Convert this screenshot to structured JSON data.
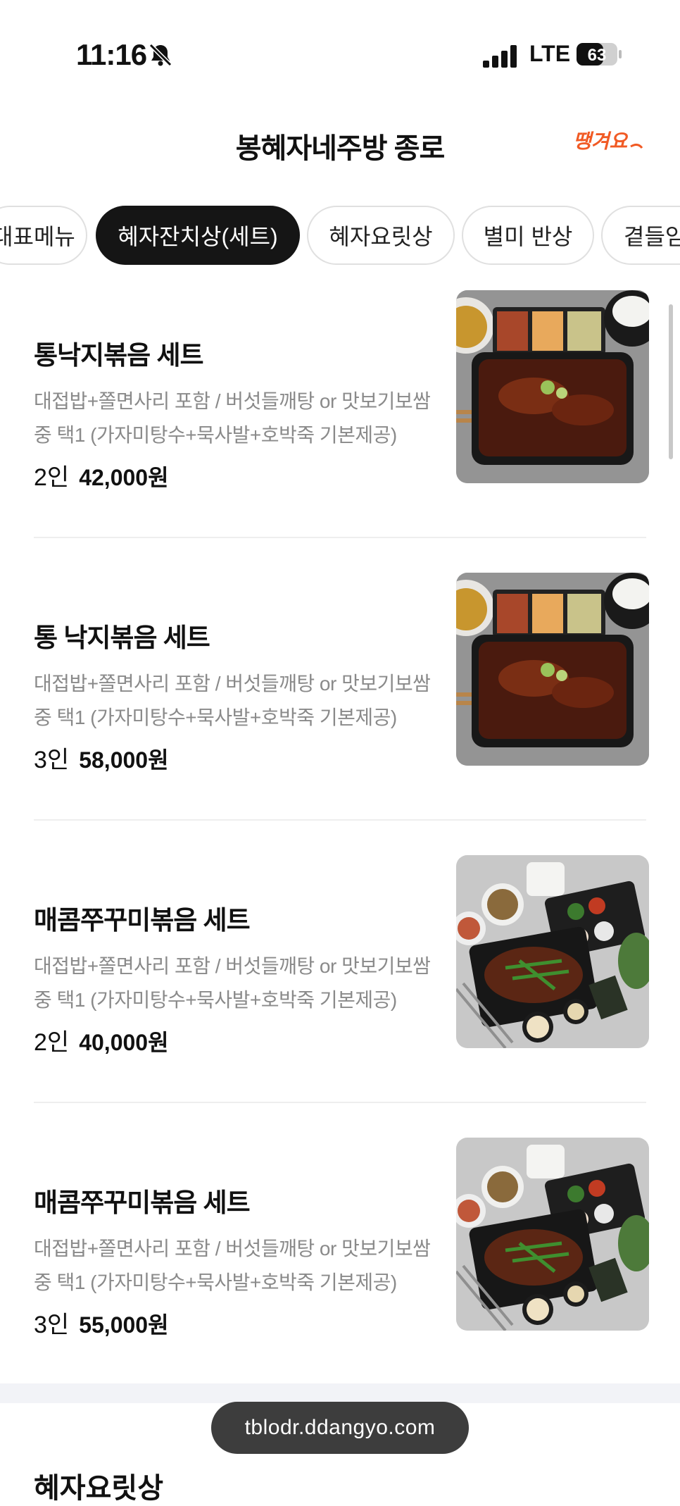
{
  "status_bar": {
    "time": "11:16",
    "network": "LTE",
    "battery": "63"
  },
  "header": {
    "title": "봉혜자네주방 종로",
    "brand_logo_text": "땡겨요"
  },
  "tabs": [
    {
      "label": "대표메뉴",
      "active": false
    },
    {
      "label": "혜자잔치상(세트)",
      "active": true
    },
    {
      "label": "혜자요릿상",
      "active": false
    },
    {
      "label": "별미 반상",
      "active": false
    },
    {
      "label": "곁들임",
      "active": false
    }
  ],
  "menu_items": [
    {
      "name": "통낙지볶음 세트",
      "desc_line1": "대접밥+쫄면사리 포함 / 버섯들깨탕 or 맛보기보쌈",
      "desc_line2": "중 택1 (가자미탕수+묵사발+호박죽 기본제공)",
      "people": "2인",
      "price": "42,000원",
      "image": "octopus-set-photo"
    },
    {
      "name": "통 낙지볶음 세트",
      "desc_line1": "대접밥+쫄면사리 포함 / 버섯들깨탕 or 맛보기보쌈",
      "desc_line2": "중 택1 (가자미탕수+묵사발+호박죽 기본제공)",
      "people": "3인",
      "price": "58,000원",
      "image": "octopus-set-photo"
    },
    {
      "name": "매콤쭈꾸미볶음 세트",
      "desc_line1": "대접밥+쫄면사리 포함 / 버섯들깨탕 or 맛보기보쌈",
      "desc_line2": "중 택1 (가자미탕수+묵사발+호박죽 기본제공)",
      "people": "2인",
      "price": "40,000원",
      "image": "webfoot-octopus-set-photo"
    },
    {
      "name": "매콤쭈꾸미볶음 세트",
      "desc_line1": "대접밥+쫄면사리 포함 / 버섯들깨탕 or 맛보기보쌈",
      "desc_line2": "중 택1 (가자미탕수+묵사발+호박죽 기본제공)",
      "people": "3인",
      "price": "55,000원",
      "image": "webfoot-octopus-set-photo"
    }
  ],
  "next_section_heading": "혜자요릿상",
  "url_bar": {
    "url": "tblodr.ddangyo.com"
  },
  "colors": {
    "brand": "#f15a24",
    "active_tab": "#151515",
    "section_gap": "#f2f3f7"
  }
}
